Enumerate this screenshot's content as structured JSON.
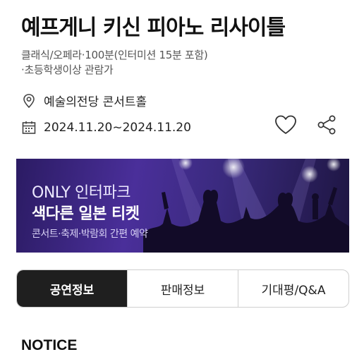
{
  "title": "예프게니 키신 피아노 리사이틀",
  "meta": {
    "line1": "클래식/오페라·100분(인터미션 15분 포함)",
    "line2": "·초등학생이상 관람가"
  },
  "venue": {
    "icon": "location-pin-icon",
    "text": "예술의전당 콘서트홀"
  },
  "date": {
    "icon": "calendar-icon",
    "text": "2024.11.20~2024.11.20"
  },
  "actions": {
    "like_icon": "heart-icon",
    "share_icon": "share-icon"
  },
  "banner": {
    "line1": "ONLY 인터파크",
    "line2": "색다른 일본 티켓",
    "line3": "콘서트·축제·박람회 간편 예약",
    "colors": {
      "bg_start": "#2b1b63",
      "bg_mid": "#4a2f9a",
      "bg_end": "#1d1540"
    }
  },
  "tabs": [
    {
      "label": "공연정보",
      "active": true
    },
    {
      "label": "판매정보",
      "active": false
    },
    {
      "label": "기대평/Q&A",
      "active": false
    }
  ],
  "notice_heading": "NOTICE"
}
